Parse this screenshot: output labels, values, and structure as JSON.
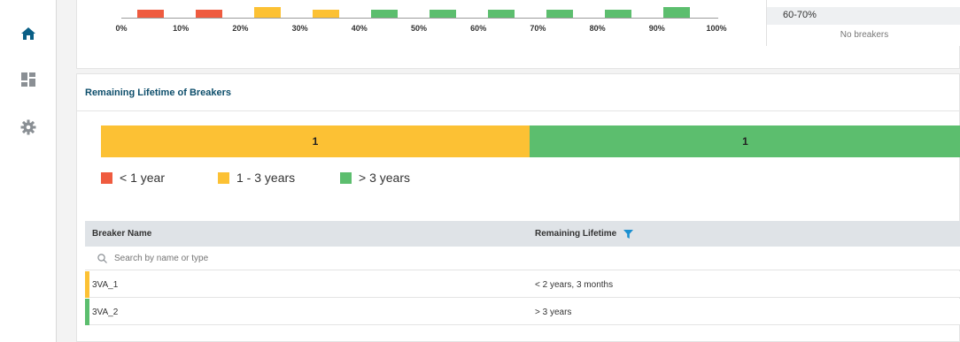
{
  "nav": {
    "items": [
      {
        "icon": "home-icon",
        "active": true
      },
      {
        "icon": "dashboard-icon",
        "active": false
      },
      {
        "icon": "gear-icon",
        "active": false
      }
    ],
    "active_color": "#0a5f86",
    "inactive_color": "#8a8f94"
  },
  "top_chart": {
    "tick_labels": [
      "0%",
      "10%",
      "20%",
      "30%",
      "40%",
      "50%",
      "60%",
      "70%",
      "80%",
      "90%",
      "100%"
    ]
  },
  "side_panel": {
    "range_label": "60-70%",
    "empty_text": "No breakers"
  },
  "lifetime_card": {
    "title": "Remaining Lifetime of Breakers",
    "chart_data": {
      "type": "bar",
      "orientation": "horizontal-stacked",
      "categories": [
        "< 1 year",
        "1 - 3 years",
        "> 3 years"
      ],
      "values": [
        0,
        1,
        1
      ],
      "data_labels": [
        "",
        "1",
        "1"
      ],
      "colors": [
        "#ef5b3f",
        "#fcc134",
        "#5cbe6e"
      ]
    },
    "legend": [
      {
        "label": "< 1 year",
        "color": "#ef5b3f"
      },
      {
        "label": "1 - 3 years",
        "color": "#fcc134"
      },
      {
        "label": "> 3 years",
        "color": "#5cbe6e"
      }
    ]
  },
  "table": {
    "columns": [
      "Breaker Name",
      "Remaining Lifetime"
    ],
    "search_placeholder": "Search by name or type",
    "rows": [
      {
        "name": "3VA_1",
        "lifetime": "< 2 years, 3 months",
        "status_color": "#fcc134"
      },
      {
        "name": "3VA_2",
        "lifetime": "> 3 years",
        "status_color": "#5cbe6e"
      }
    ],
    "filter_icon_color": "#1a8fd0"
  }
}
